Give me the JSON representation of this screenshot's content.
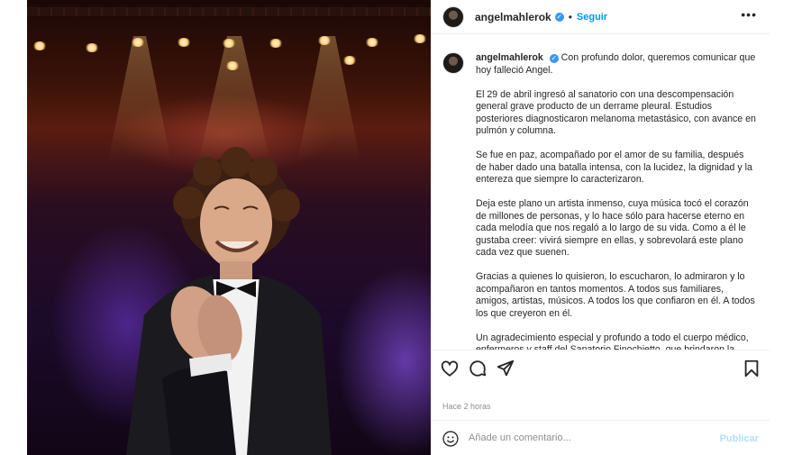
{
  "post": {
    "username": "angelmahlerok",
    "verified_icon": "verified-badge-icon",
    "follow_label": "Seguir",
    "more_icon": "more-options-icon"
  },
  "caption": {
    "paragraphs": [
      "Con profundo dolor, queremos comunicar que hoy falleció Angel.",
      "El 29 de abril ingresó al sanatorio con una descompensación general grave producto de un derrame pleural. Estudios posteriores diagnosticaron melanoma metastásico, con avance en pulmón y columna.",
      "Se fue en paz, acompañado por el amor de su familia, después de haber dado una batalla intensa, con la lucidez, la dignidad y la entereza que siempre lo caracterizaron.",
      "Deja este plano un artista inmenso, cuya música tocó el corazón de millones de personas, y lo hace sólo para hacerse eterno en cada melodía que nos regaló a lo largo de su vida. Como a él le gustaba creer: vivirá siempre en ellas, y sobrevolará este plano cada vez que suenen.",
      "Gracias a quienes lo quisieron, lo escucharon, lo admiraron y lo acompañaron en tantos momentos. A todos sus familiares, amigos, artistas, músicos. A todos los que confiaron en él. A todos los que creyeron en él.",
      "Un agradecimiento especial y profundo a todo el cuerpo médico, enfermeros y staff del Sanatorio Finochietto, que brindaron la dedicación y el cuidado que Angel necesitaba."
    ]
  },
  "actions": {
    "like_icon": "heart-icon",
    "comment_icon": "comment-icon",
    "share_icon": "share-icon",
    "save_icon": "bookmark-icon"
  },
  "timestamp": "Hace 2 horas",
  "comment": {
    "emoji_icon": "emoji-icon",
    "placeholder": "Añade un comentario...",
    "publish_label": "Publicar"
  },
  "colors": {
    "link_blue": "#0095f6",
    "publish_disabled": "#b2dffc",
    "muted_text": "#8e8e8e"
  }
}
